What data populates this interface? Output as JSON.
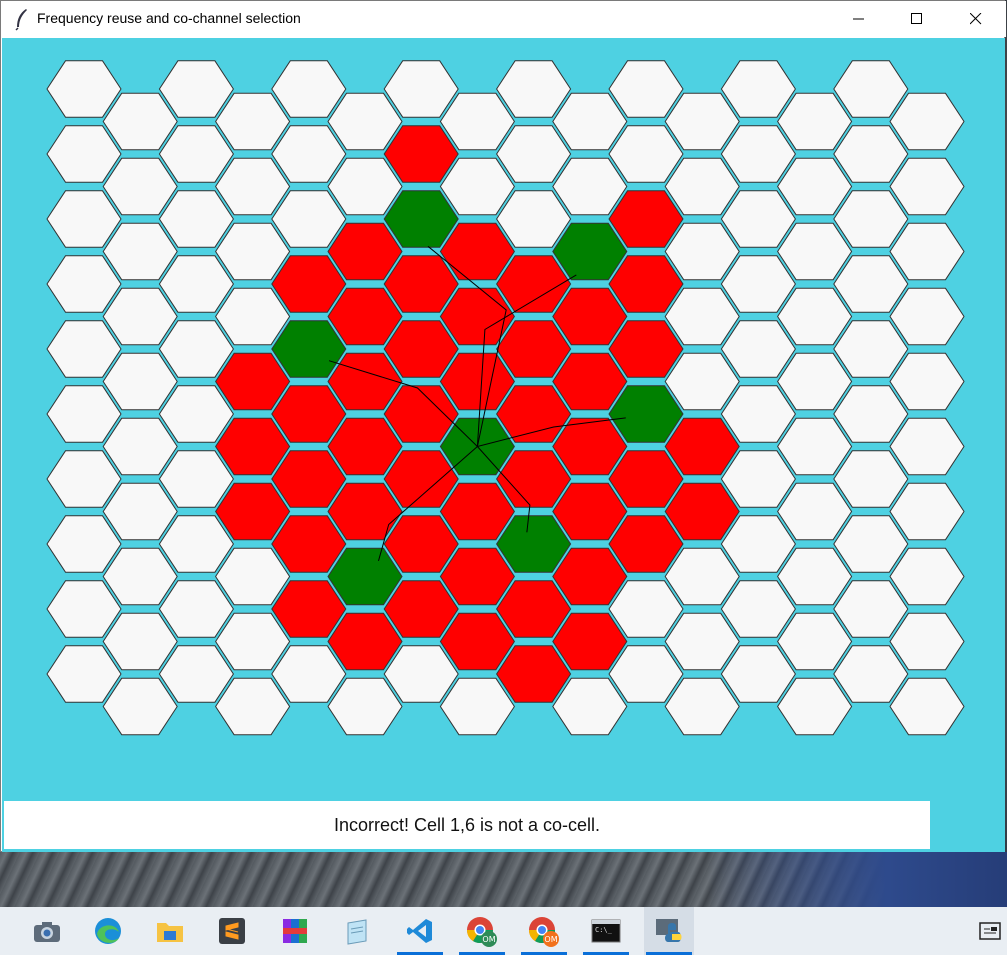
{
  "window": {
    "title": "Frequency reuse and co-channel selection"
  },
  "status": {
    "message": "Incorrect! Cell 1,6 is not a co-cell."
  },
  "colors": {
    "background": "#4ed1e2",
    "cell_default": "#f8f8f8",
    "cell_interference": "#ff0000",
    "cell_cochannel": "#008000",
    "cell_border": "#333333",
    "line": "#000000"
  },
  "grid": {
    "columns": 16,
    "rows_even_col": 10,
    "rows_odd_col": 10
  },
  "cells": {
    "green": [
      [
        7,
        5
      ],
      [
        6,
        2
      ],
      [
        9,
        2
      ],
      [
        4,
        4
      ],
      [
        10,
        5
      ],
      [
        5,
        7
      ],
      [
        8,
        7
      ]
    ],
    "red": [
      [
        6,
        1
      ],
      [
        5,
        2
      ],
      [
        7,
        2
      ],
      [
        5,
        3
      ],
      [
        6,
        3
      ],
      [
        7,
        3
      ],
      [
        8,
        3
      ],
      [
        9,
        3
      ],
      [
        10,
        2
      ],
      [
        10,
        3
      ],
      [
        3,
        4
      ],
      [
        4,
        3
      ],
      [
        5,
        4
      ],
      [
        6,
        4
      ],
      [
        7,
        4
      ],
      [
        8,
        4
      ],
      [
        9,
        4
      ],
      [
        10,
        4
      ],
      [
        11,
        5
      ],
      [
        3,
        5
      ],
      [
        3,
        6
      ],
      [
        4,
        5
      ],
      [
        5,
        5
      ],
      [
        6,
        5
      ],
      [
        8,
        5
      ],
      [
        9,
        5
      ],
      [
        4,
        6
      ],
      [
        5,
        6
      ],
      [
        6,
        6
      ],
      [
        7,
        6
      ],
      [
        8,
        6
      ],
      [
        9,
        6
      ],
      [
        10,
        6
      ],
      [
        11,
        6
      ],
      [
        4,
        7
      ],
      [
        6,
        7
      ],
      [
        7,
        7
      ],
      [
        9,
        7
      ],
      [
        4,
        8
      ],
      [
        5,
        8
      ],
      [
        6,
        8
      ],
      [
        7,
        8
      ],
      [
        8,
        8
      ],
      [
        9,
        8
      ],
      [
        10,
        7
      ],
      [
        8,
        9
      ]
    ]
  },
  "taskbar": {
    "items": [
      {
        "name": "camera-app",
        "running": false
      },
      {
        "name": "edge-browser",
        "running": false
      },
      {
        "name": "file-explorer",
        "running": false
      },
      {
        "name": "sublime-text",
        "running": false
      },
      {
        "name": "winrar",
        "running": false
      },
      {
        "name": "notepad",
        "running": false
      },
      {
        "name": "vscode",
        "running": true
      },
      {
        "name": "chrome-profile-1",
        "running": true
      },
      {
        "name": "chrome-profile-2",
        "running": true
      },
      {
        "name": "command-prompt",
        "running": true
      },
      {
        "name": "python-idle",
        "running": true
      }
    ],
    "chrome_badge": "OM"
  }
}
